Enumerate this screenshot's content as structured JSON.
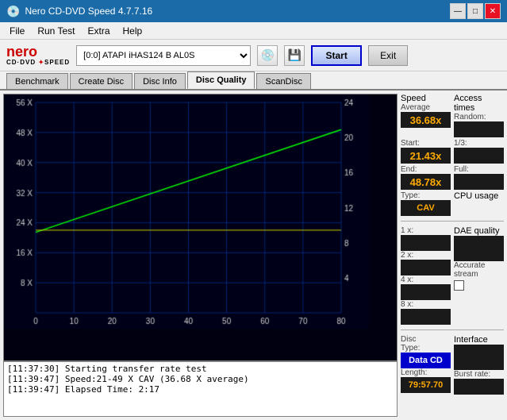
{
  "titleBar": {
    "title": "Nero CD-DVD Speed 4.7.7.16",
    "minimizeBtn": "—",
    "maximizeBtn": "□",
    "closeBtn": "✕"
  },
  "menu": {
    "items": [
      "File",
      "Run Test",
      "Extra",
      "Help"
    ]
  },
  "toolbar": {
    "drive": "[0:0]  ATAPI iHAS124  B AL0S",
    "startLabel": "Start",
    "exitLabel": "Exit"
  },
  "tabs": [
    "Benchmark",
    "Create Disc",
    "Disc Info",
    "Disc Quality",
    "ScanDisc"
  ],
  "chart": {
    "title": "Disc Quality",
    "yMax": 56,
    "yAxisLabels": [
      "8 X",
      "16 X",
      "24 X",
      "32 X",
      "40 X",
      "48 X",
      "56 X"
    ],
    "xAxisLabels": [
      "0",
      "10",
      "20",
      "30",
      "40",
      "50",
      "60",
      "70",
      "80"
    ],
    "rightAxisLabels": [
      "4",
      "8",
      "12",
      "16",
      "20",
      "24"
    ],
    "gridColorH": "#003388",
    "gridColorV": "#003388"
  },
  "speedPanel": {
    "speedLabel": "Speed",
    "averageLabel": "Average",
    "averageValue": "36.68x",
    "startLabel": "Start:",
    "startValue": "21.43x",
    "endLabel": "End:",
    "endValue": "48.78x",
    "typeLabel": "Type:",
    "typeValue": "CAV"
  },
  "accessTimes": {
    "label": "Access times",
    "randomLabel": "Random:",
    "randomValue": "",
    "oneThirdLabel": "1/3:",
    "oneThirdValue": "",
    "fullLabel": "Full:",
    "fullValue": ""
  },
  "cpuUsage": {
    "label": "CPU usage",
    "x1Label": "1 x:",
    "x1Value": "",
    "x2Label": "2 x:",
    "x2Value": "",
    "x4Label": "4 x:",
    "x4Value": "",
    "x8Label": "8 x:",
    "x8Value": ""
  },
  "daeQuality": {
    "label": "DAE quality",
    "value": "",
    "accurateStreamLabel": "Accurate",
    "accurateStreamLabel2": "stream",
    "checked": false
  },
  "discInfo": {
    "typeLabel": "Disc",
    "typeLabel2": "Type:",
    "typeValue": "Data CD",
    "lengthLabel": "Length:",
    "lengthValue": "79:57.70"
  },
  "interface": {
    "label": "Interface",
    "burstLabel": "Burst rate:",
    "burstValue": ""
  },
  "log": {
    "lines": [
      "[11:37:30]  Starting transfer rate test",
      "[11:39:47]  Speed:21-49 X CAV (36.68 X average)",
      "[11:39:47]  Elapsed Time: 2:17"
    ]
  }
}
